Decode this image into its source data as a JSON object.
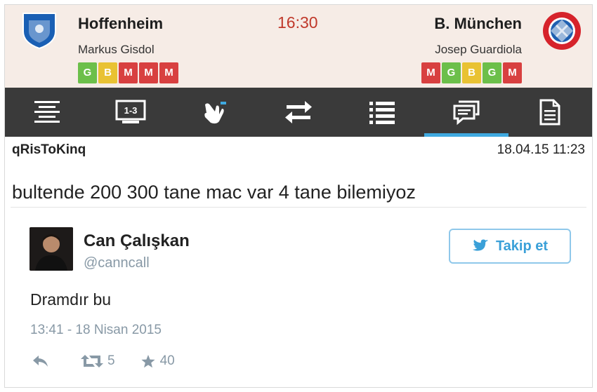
{
  "match": {
    "home": {
      "name": "Hoffenheim",
      "coach": "Markus Gisdol",
      "form": [
        "G",
        "B",
        "M",
        "M",
        "M"
      ],
      "crest_icon": "hoffenheim-crest-icon",
      "crest_color": "#1a5fb4"
    },
    "away": {
      "name": "B. München",
      "coach": "Josep Guardiola",
      "form": [
        "M",
        "G",
        "B",
        "G",
        "M"
      ],
      "crest_icon": "bayern-crest-icon",
      "crest_color": "#d6232b"
    },
    "time": "16:30",
    "form_colors": {
      "G": "#6cbf4a",
      "B": "#e9c233",
      "M": "#d84040"
    }
  },
  "tabs": [
    {
      "icon": "align-center-icon",
      "active": false
    },
    {
      "icon": "scoreboard-icon",
      "active": false
    },
    {
      "icon": "hand-icon",
      "active": false
    },
    {
      "icon": "swap-arrows-icon",
      "active": false
    },
    {
      "icon": "list-icon",
      "active": false
    },
    {
      "icon": "comments-icon",
      "active": true
    },
    {
      "icon": "document-icon",
      "active": false
    }
  ],
  "comment": {
    "username": "qRisToKinq",
    "date": "18.04.15 11:23",
    "text": "bultende 200 300 tane mac var 4 tane bilemiyoz"
  },
  "tweet": {
    "name": "Can Çalışkan",
    "handle": "@canncall",
    "follow_label": "Takip et",
    "text": "Dramdır bu",
    "time": "13:41 - 18 Nisan 2015",
    "retweets": "5",
    "favorites": "40"
  },
  "colors": {
    "accent": "#3fa9e0",
    "tabbar": "#3a3a3a",
    "header_bg": "#f6ece6",
    "time": "#c0392b"
  }
}
